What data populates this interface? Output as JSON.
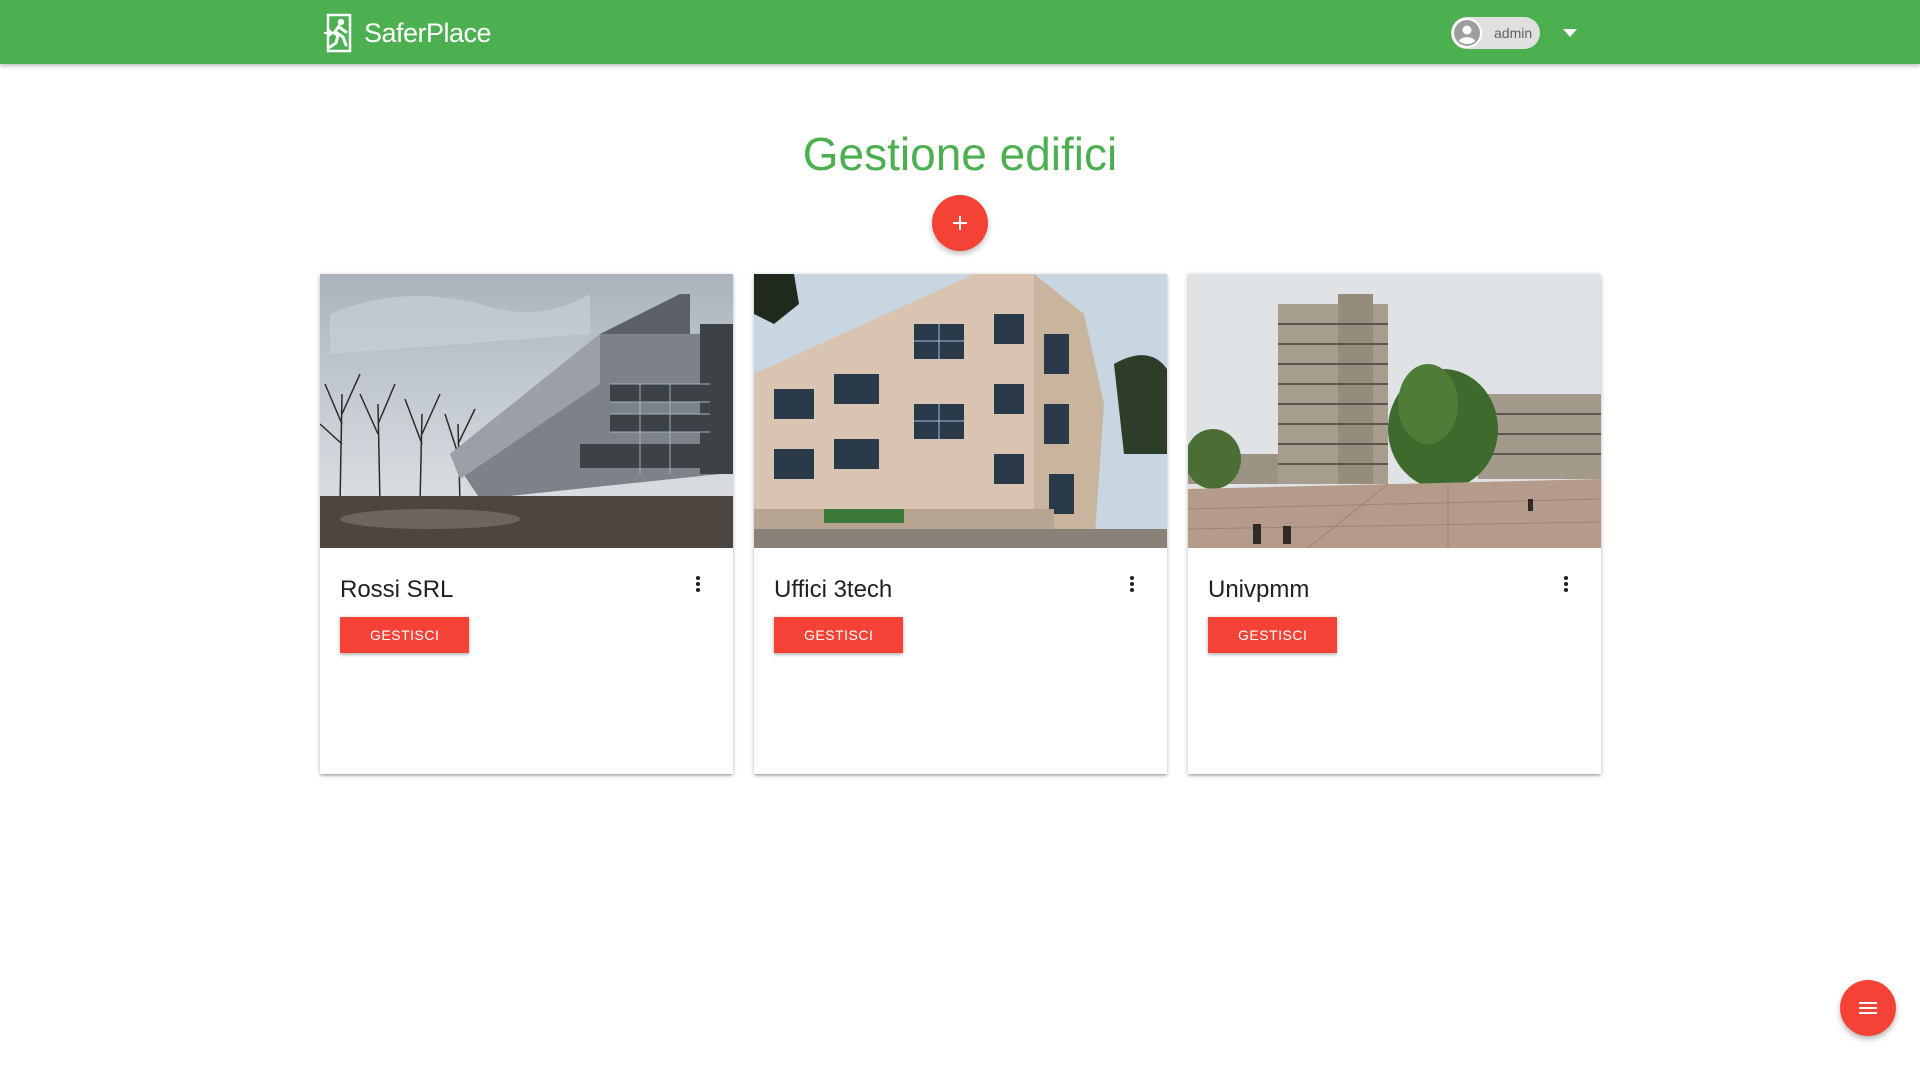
{
  "header": {
    "brand": "SaferPlace",
    "user_label": "admin",
    "logo_icon": "emergency-exit-icon",
    "avatar_icon": "account-circle-icon",
    "dropdown_icon": "caret-down-icon",
    "color": "#4caf50"
  },
  "main": {
    "title": "Gestione edifici",
    "add_button_icon": "plus-icon",
    "accent_color": "#f44336"
  },
  "buildings": [
    {
      "name": "Rossi SRL",
      "button_label": "GESTISCI",
      "menu_icon": "more-vert-icon",
      "image_alt": "modern glass and steel building"
    },
    {
      "name": "Uffici 3tech",
      "button_label": "GESTISCI",
      "menu_icon": "more-vert-icon",
      "image_alt": "curved office building with windows"
    },
    {
      "name": "Univpmm",
      "button_label": "GESTISCI",
      "menu_icon": "more-vert-icon",
      "image_alt": "university campus tower"
    }
  ],
  "fab_menu_icon": "menu-icon"
}
